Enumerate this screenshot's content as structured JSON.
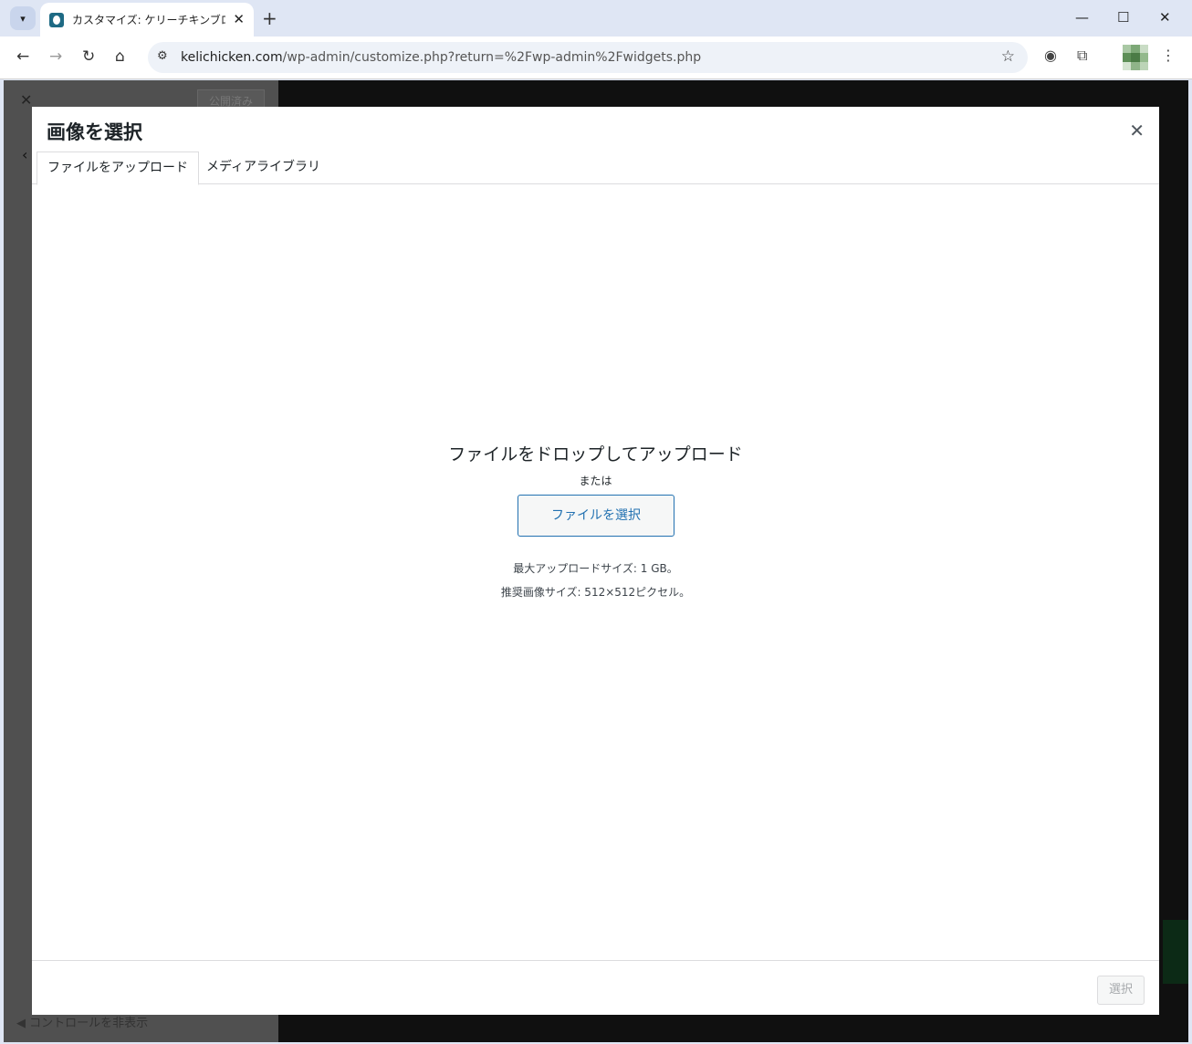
{
  "browser": {
    "tab_title": "カスタマイズ: ケリーチキンブログ | ケリ",
    "url_host": "kelichicken.com",
    "url_path": "/wp-admin/customize.php?return=%2Fwp-admin%2Fwidgets.php",
    "icons": {
      "tab_search": "▾",
      "tab_close": "✕",
      "new_tab": "+",
      "minimize": "—",
      "maximize": "☐",
      "close": "✕",
      "back": "←",
      "forward": "→",
      "reload": "↻",
      "home": "⌂",
      "site_info": "⚙",
      "star": "☆",
      "extension_a": "◉",
      "extensions": "⧉",
      "menu": "⋮"
    }
  },
  "customizer": {
    "close_icon": "✕",
    "publish_label": "公開済み",
    "back_icon": "‹",
    "hide_controls": "◀ コントロールを非表示"
  },
  "modal": {
    "title": "画像を選択",
    "close_icon": "✕",
    "tabs": [
      "ファイルをアップロード",
      "メディアライブラリ"
    ],
    "drop_title": "ファイルをドロップしてアップロード",
    "or_text": "または",
    "select_files_label": "ファイルを選択",
    "max_upload_size": "最大アップロードサイズ: 1 GB。",
    "recommended_size": "推奨画像サイズ: 512×512ピクセル。",
    "select_button_label": "選択",
    "select_button_enabled": false
  },
  "colors": {
    "accent": "#2271b1",
    "overlay": "#101010"
  }
}
